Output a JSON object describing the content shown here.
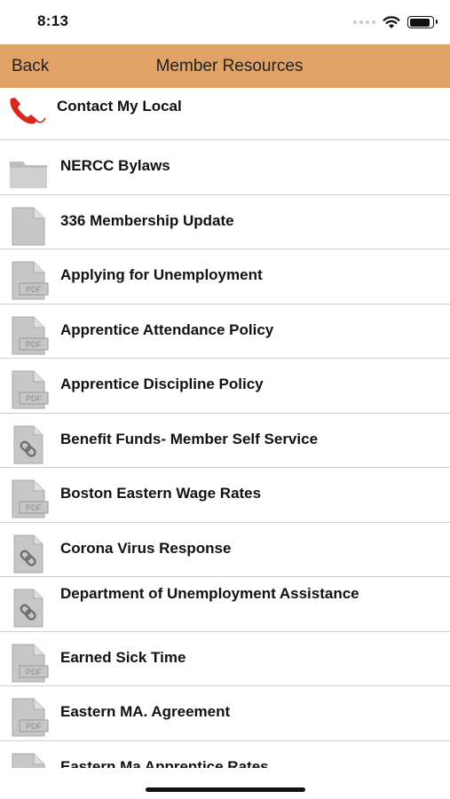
{
  "status_bar": {
    "time": "8:13"
  },
  "nav": {
    "back_label": "Back",
    "title": "Member Resources"
  },
  "items": [
    {
      "label": "Contact My Local",
      "icon": "phone-icon"
    },
    {
      "label": "NERCC Bylaws",
      "icon": "folder-icon"
    },
    {
      "label": "336 Membership Update",
      "icon": "document-icon"
    },
    {
      "label": "Applying for Unemployment",
      "icon": "pdf-icon"
    },
    {
      "label": "Apprentice Attendance Policy",
      "icon": "pdf-icon"
    },
    {
      "label": "Apprentice Discipline Policy",
      "icon": "pdf-icon"
    },
    {
      "label": "Benefit Funds- Member Self Service",
      "icon": "link-icon"
    },
    {
      "label": "Boston Eastern Wage Rates",
      "icon": "pdf-icon"
    },
    {
      "label": "Corona Virus Response",
      "icon": "link-icon"
    },
    {
      "label": "Department of Unemployment Assistance",
      "icon": "link-icon"
    },
    {
      "label": "Earned Sick Time",
      "icon": "pdf-icon"
    },
    {
      "label": "Eastern MA. Agreement",
      "icon": "pdf-icon"
    },
    {
      "label": "Eastern Ma Apprentice Rates",
      "icon": "pdf-icon"
    }
  ],
  "icon_text": {
    "pdf": "PDF"
  },
  "colors": {
    "nav_background": "#e0a365",
    "icon_gray": "#c7c7c7",
    "phone_red": "#d52a20"
  }
}
